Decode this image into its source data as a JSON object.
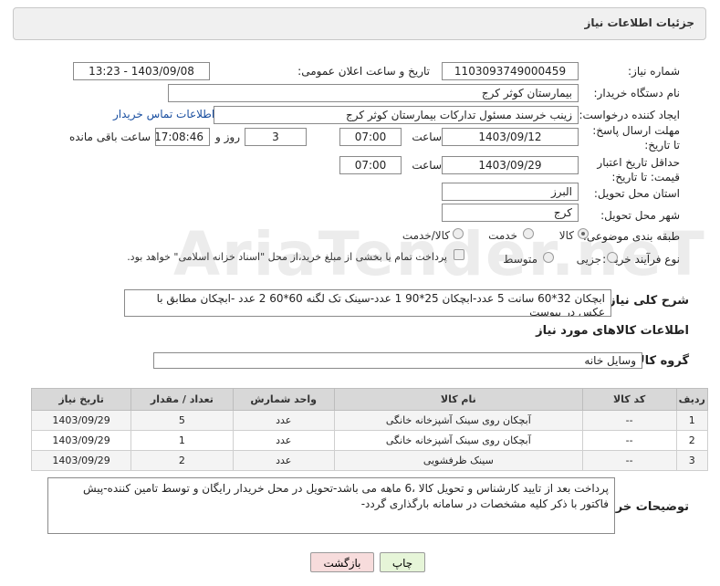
{
  "header": {
    "title": "جزئیات اطلاعات نیاز"
  },
  "labels": {
    "need_number": "شماره نیاز:",
    "announce_datetime": "تاریخ و ساعت اعلان عمومی:",
    "buyer_org": "نام دستگاه خریدار:",
    "requester": "ایجاد کننده درخواست:",
    "buyer_contact": "اطلاعات تماس خریدار",
    "reply_deadline": "مهلت ارسال پاسخ: تا تاریخ:",
    "hour": "ساعت",
    "day_and": "روز و",
    "time_remaining": "ساعت باقی مانده",
    "price_validity": "حداقل تاریخ اعتبار قیمت: تا تاریخ:",
    "delivery_province": "استان محل تحویل:",
    "delivery_city": "شهر محل تحویل:",
    "subject_class": "طبقه بندی موضوعی:",
    "purchase_type": "نوع فرآیند خرید :",
    "need_description": "شرح کلی نیاز:",
    "goods_info": "اطلاعات کالاهای مورد نیاز",
    "goods_group": "گروه کالا:",
    "buyer_notes": "توضیحات خریدار:"
  },
  "values": {
    "need_number": "1103093749000459",
    "announce_datetime": "1403/09/08 - 13:23",
    "buyer_org": "بیمارستان کوثر کرج",
    "requester": "زینب خرسند مسئول تدارکات بیمارستان کوثر کرج",
    "reply_date": "1403/09/12",
    "reply_time": "07:00",
    "reply_days": "3",
    "remaining_time": "17:08:46",
    "validity_date": "1403/09/29",
    "validity_time": "07:00",
    "province": "البرز",
    "city": "کرج",
    "need_description": "ابچکان 32*60 سانت  5 عدد-ابچکان  25*90 1 عدد-سینک تک لگنه  60*60  2 عدد -ابچکان مطابق با عکس در پیوست",
    "goods_group": "وسایل خانه",
    "buyer_notes": "پرداخت بعد از تایید کارشناس و تحویل کالا ،6 ماهه می باشد-تحویل در محل خریدار رایگان و توسط تامین کننده-پیش فاکتور با ذکر کلیه مشخصات در سامانه بارگذاری گردد-"
  },
  "subject_options": [
    {
      "label": "کالا",
      "selected": true
    },
    {
      "label": "خدمت",
      "selected": false
    },
    {
      "label": "کالا/خدمت",
      "selected": false
    }
  ],
  "purchase_options": [
    {
      "label": "جزیی",
      "selected": false
    },
    {
      "label": "متوسط",
      "selected": false
    }
  ],
  "payment_note": "پرداخت تمام یا بخشی از مبلغ خرید،از محل \"اسناد خزانه اسلامی\" خواهد بود.",
  "table": {
    "headers": [
      "ردیف",
      "کد کالا",
      "نام کالا",
      "واحد شمارش",
      "تعداد / مقدار",
      "تاریخ نیاز"
    ],
    "rows": [
      [
        "1",
        "--",
        "آبچکان روی سینک آشپزخانه خانگی",
        "عدد",
        "5",
        "1403/09/29"
      ],
      [
        "2",
        "--",
        "آبچکان روی سینک آشپزخانه خانگی",
        "عدد",
        "1",
        "1403/09/29"
      ],
      [
        "3",
        "--",
        "سینک ظرفشویی",
        "عدد",
        "2",
        "1403/09/29"
      ]
    ]
  },
  "buttons": {
    "print": "چاپ",
    "back": "بازگشت"
  },
  "watermark": "AriaTender.neT"
}
